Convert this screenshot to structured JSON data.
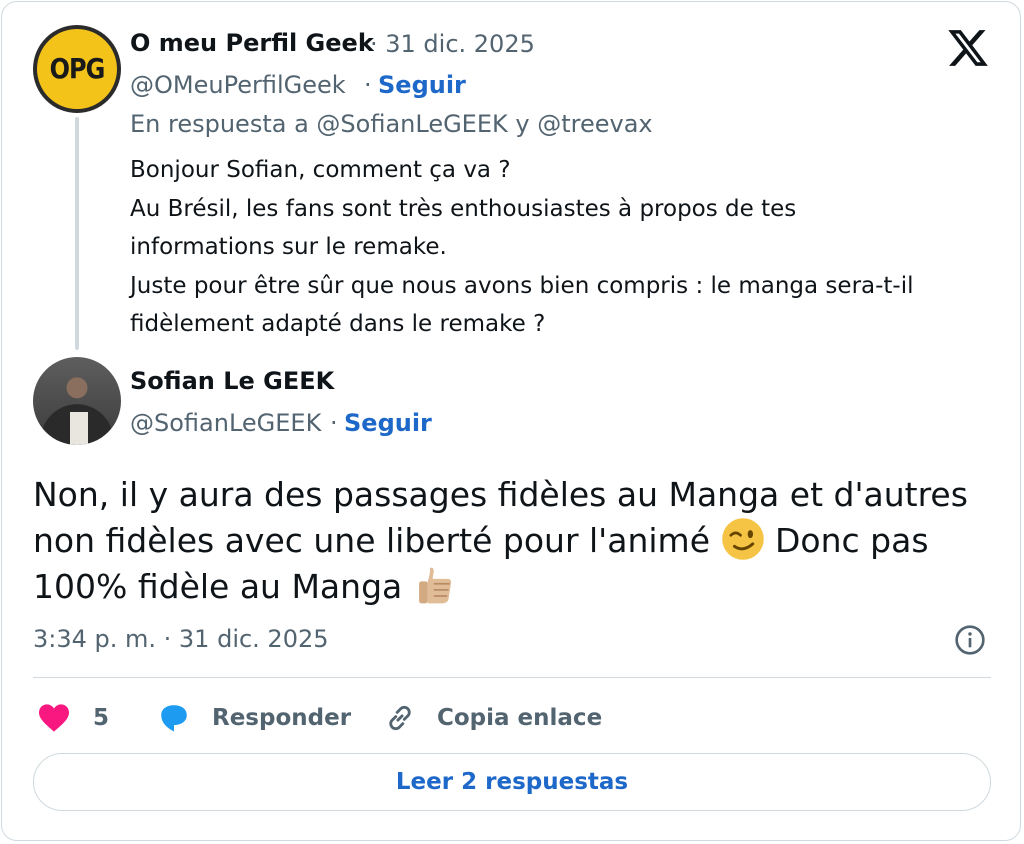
{
  "parent": {
    "avatar_text": "OPG",
    "name": "O meu Perfil Geek",
    "date": "· 31 dic. 2025",
    "handle": "@OMeuPerfilGeek",
    "separator": "·",
    "follow_label": "Seguir",
    "reply_to": "En respuesta a @SofianLeGEEK y @treevax",
    "text_lines": [
      "Bonjour Sofian, comment ça va ?",
      "Au Brésil, les fans sont très enthousiastes à propos de tes",
      "informations sur le remake.",
      "Juste pour être sûr que nous avons bien compris : le manga sera-t-il",
      "fidèlement adapté dans le remake ?"
    ]
  },
  "tweet": {
    "name": "Sofian Le GEEK",
    "handle": "@SofianLeGEEK",
    "separator": "·",
    "follow_label": "Seguir",
    "text_line1": "Non, il y aura des passages fidèles au Manga et d'autres",
    "text_line2": "non fidèles avec une liberté pour l'animé",
    "text_line2b": "Donc pas",
    "text_line3": "100% fidèle au Manga",
    "emoji_wink": "winking-face",
    "emoji_thumbs": "thumbs-up-light-skin",
    "timestamp": "3:34 p. m. · 31 dic. 2025"
  },
  "actions": {
    "like_count": "5",
    "reply_label": "Responder",
    "copy_label": "Copia enlace"
  },
  "read_replies_label": "Leer 2 respuestas",
  "colors": {
    "link_blue": "#1d68c8",
    "secondary_text": "#536471",
    "like_red": "#f91880",
    "reply_blue": "#1d9bf0",
    "border": "#cfd9de"
  }
}
